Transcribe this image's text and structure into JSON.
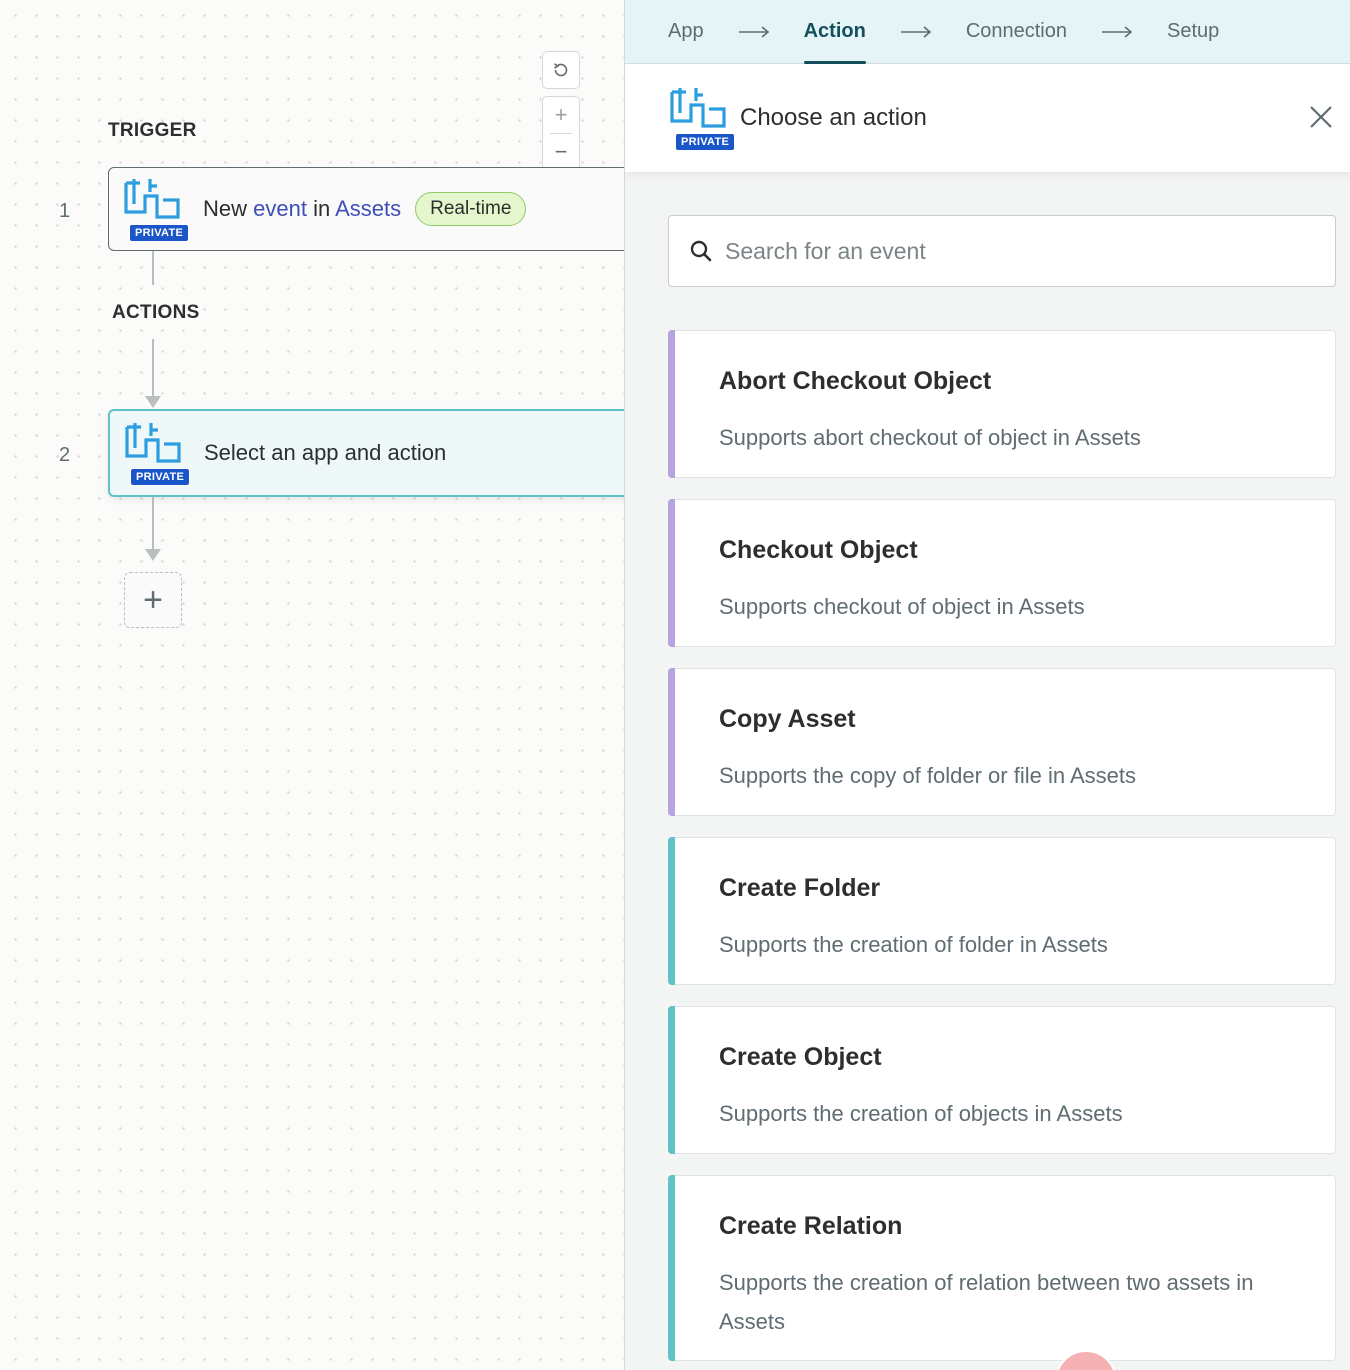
{
  "canvas": {
    "trigger_label": "TRIGGER",
    "actions_label": "ACTIONS",
    "trigger_step": {
      "number": "1",
      "badge": "PRIVATE",
      "title_prefix": "New ",
      "title_event": "event",
      "title_mid": " in ",
      "title_app": "Assets",
      "status": "Real-time"
    },
    "action_step": {
      "number": "2",
      "badge": "PRIVATE",
      "title": "Select an app and action"
    },
    "add_step": "+",
    "controls": {
      "reset": "reset-icon",
      "zoom_in": "+",
      "zoom_out": "−",
      "fit": "fit-view-icon"
    }
  },
  "panel": {
    "nav": [
      {
        "label": "App"
      },
      {
        "label": "Action"
      },
      {
        "label": "Connection"
      },
      {
        "label": "Setup"
      }
    ],
    "header": {
      "badge": "PRIVATE",
      "title": "Choose an action"
    },
    "search": {
      "placeholder": "Search for an event",
      "value": ""
    },
    "actions": [
      {
        "title": "Abort Checkout Object",
        "desc": "Supports abort checkout of object in Assets",
        "accent": "#b6a3e0"
      },
      {
        "title": "Checkout Object",
        "desc": "Supports checkout of object in Assets",
        "accent": "#b6a3e0"
      },
      {
        "title": "Copy Asset",
        "desc": "Supports the copy of folder or file in Assets",
        "accent": "#b6a3e0"
      },
      {
        "title": "Create Folder",
        "desc": "Supports the creation of folder in Assets",
        "accent": "#5fc2c8"
      },
      {
        "title": "Create Object",
        "desc": "Supports the creation of objects in Assets",
        "accent": "#5fc2c8"
      },
      {
        "title": "Create Relation",
        "desc": "Supports the creation of relation between two assets in Assets",
        "accent": "#5fc2c8"
      }
    ]
  },
  "colors": {
    "accent_purple": "#b6a3e0",
    "accent_teal": "#5fc2c8",
    "nav_active": "#14505c",
    "badge_blue": "#1a56c9"
  }
}
